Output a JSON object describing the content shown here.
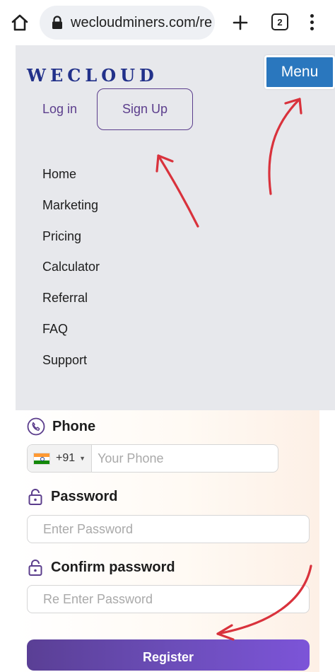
{
  "browser": {
    "url": "wecloudminers.com/re",
    "tab_count": "2"
  },
  "site": {
    "logo_text": "WECLOUD",
    "login_label": "Log in",
    "signup_label": "Sign Up",
    "menu_button_label": "Menu",
    "nav_items": [
      "Home",
      "Marketing",
      "Pricing",
      "Calculator",
      "Referral",
      "FAQ",
      "Support"
    ]
  },
  "form": {
    "phone_label": "Phone",
    "country_code": "+91",
    "phone_placeholder": "Your Phone",
    "password_label": "Password",
    "password_placeholder": "Enter Password",
    "confirm_label": "Confirm password",
    "confirm_placeholder": "Re Enter Password",
    "register_label": "Register"
  },
  "colors": {
    "menu_button": "#2a77be",
    "brand_purple": "#5b3d8c",
    "logo_navy": "#22318a",
    "annotation_red": "#d9323c"
  },
  "icons": {
    "home": "home-icon",
    "lock": "lock-icon",
    "new_tab": "plus-icon",
    "tabs": "tabs-icon",
    "overflow": "more-vert-icon",
    "phone": "phone-icon",
    "padlock": "padlock-icon",
    "flag": "india-flag-icon",
    "dropdown": "caret-down-icon"
  }
}
